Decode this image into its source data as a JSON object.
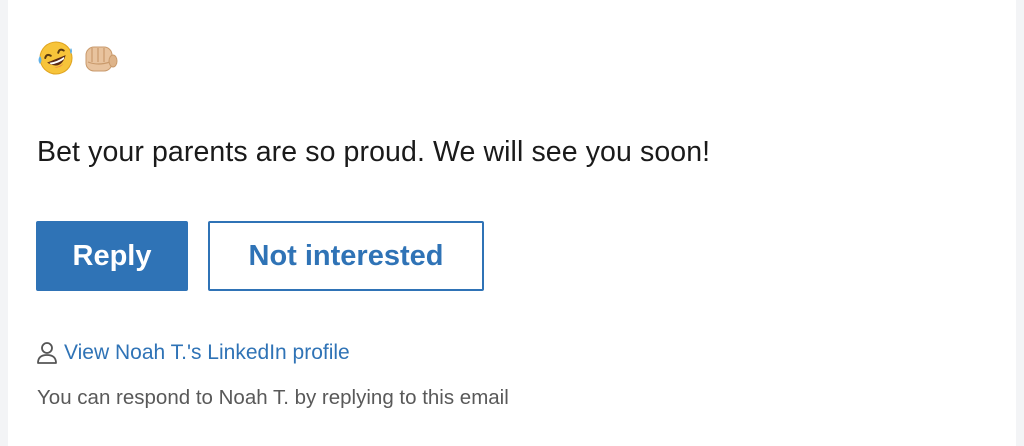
{
  "emojis": [
    {
      "name": "rolling-on-the-floor-laughing",
      "glyph": "🤣"
    },
    {
      "name": "oncoming-fist",
      "glyph": "👊"
    }
  ],
  "message": {
    "text": "Bet your parents are so proud. We will see you soon!"
  },
  "actions": {
    "reply_label": "Reply",
    "not_interested_label": "Not interested"
  },
  "profile": {
    "link_text": "View Noah T.'s LinkedIn profile",
    "icon": "person-icon"
  },
  "footer": {
    "note": "You can respond to Noah T. by replying to this email"
  },
  "colors": {
    "accent": "#2f73b6",
    "text": "#1a1a1a",
    "muted": "#595959"
  }
}
